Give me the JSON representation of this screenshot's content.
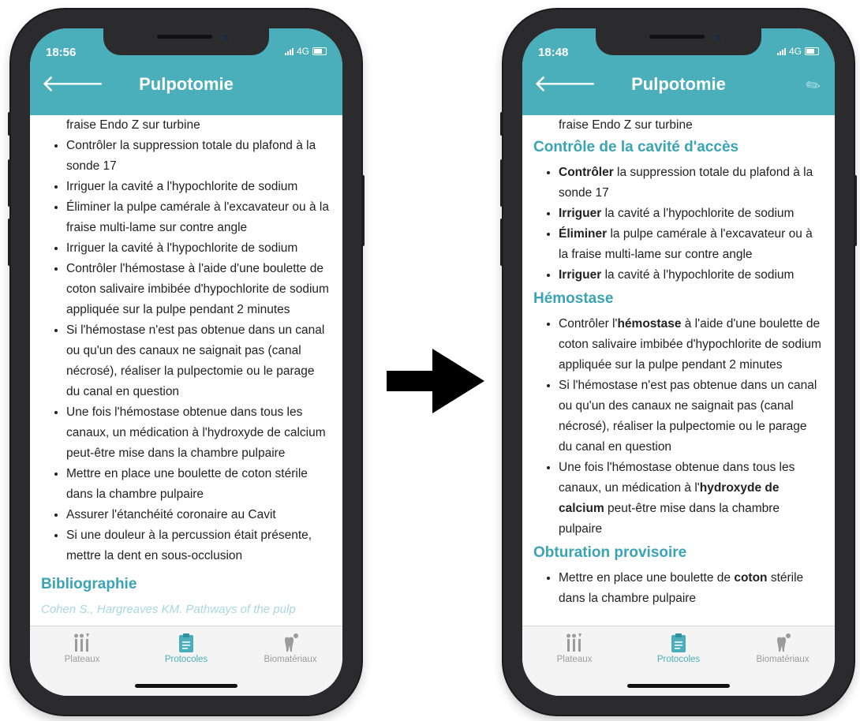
{
  "left": {
    "status": {
      "time": "18:56",
      "network": "4G"
    },
    "header": {
      "title": "Pulpotomie"
    },
    "content": {
      "top_fragment": "fraise Endo Z sur turbine",
      "items": [
        "Contrôler la suppression totale du plafond à la sonde 17",
        "Irriguer la cavité a l'hypochlorite de sodium",
        "Éliminer la pulpe camérale à l'excavateur ou à la fraise multi-lame sur contre angle",
        "Irriguer la cavité à l'hypochlorite de sodium",
        "Contrôler l'hémostase à l'aide d'une boulette de coton salivaire imbibée d'hypochlorite de sodium appliquée sur la pulpe pendant 2 minutes",
        "Si l'hémostase n'est pas obtenue dans un canal ou qu'un des canaux ne saignait pas (canal nécrosé), réaliser la pulpectomie ou le parage du canal en question",
        "Une fois l'hémostase obtenue dans tous les canaux, un médication à l'hydroxyde de calcium peut-être mise dans la chambre pulpaire",
        "Mettre en place une boulette de coton stérile dans la chambre pulpaire",
        "Assurer l'étanchéité coronaire au Cavit",
        "Si une douleur à la percussion était présente, mettre la dent en sous-occlusion"
      ],
      "bibliography_heading": "Bibliographie",
      "bibliography_fragment": "Cohen S., Hargreaves KM. Pathways of the pulp"
    },
    "tabs": [
      {
        "label": "Plateaux",
        "icon": "tools-icon"
      },
      {
        "label": "Protocoles",
        "icon": "clipboard-icon"
      },
      {
        "label": "Biomatériaux",
        "icon": "tooth-icon"
      }
    ]
  },
  "right": {
    "status": {
      "time": "18:48",
      "network": "4G"
    },
    "header": {
      "title": "Pulpotomie"
    },
    "content": {
      "top_fragment": "fraise Endo Z sur turbine",
      "section1": {
        "heading": "Contrôle de la cavité d'accès",
        "items": [
          {
            "bold": "Contrôler",
            "rest": " la suppression totale du plafond à la sonde 17"
          },
          {
            "bold": "Irriguer",
            "rest": " la cavité a l'hypochlorite de sodium"
          },
          {
            "bold": "Éliminer",
            "rest": " la pulpe camérale à l'excavateur ou à la fraise multi-lame sur contre angle"
          },
          {
            "bold": "Irriguer",
            "rest": " la cavité à l'hypochlorite de sodium"
          }
        ]
      },
      "section2": {
        "heading": "Hémostase",
        "item1": {
          "pre": "Contrôler l'",
          "bold": "hémostase",
          "post": " à l'aide d'une boulette de coton salivaire imbibée d'hypochlorite de sodium appliquée sur la pulpe pendant 2 minutes"
        },
        "item2": "Si l'hémostase n'est pas obtenue dans un canal ou qu'un des canaux ne saignait pas (canal nécrosé), réaliser la pulpectomie ou le parage du canal en question",
        "item3": {
          "pre": "Une fois l'hémostase obtenue dans tous les canaux, un médication à l'",
          "bold": "hydroxyde de calcium",
          "post": " peut-être mise dans la chambre pulpaire"
        }
      },
      "section3": {
        "heading": "Obturation provisoire",
        "item1": {
          "pre": "Mettre en place une boulette de ",
          "bold": "coton",
          "post": " stérile dans la chambre pulpaire"
        }
      }
    },
    "tabs": [
      {
        "label": "Plateaux",
        "icon": "tools-icon"
      },
      {
        "label": "Protocoles",
        "icon": "clipboard-icon"
      },
      {
        "label": "Biomatériaux",
        "icon": "tooth-icon"
      }
    ]
  },
  "colors": {
    "header": "#4aaebb",
    "heading_text": "#3aa3b4",
    "tab_active": "#4aaebb",
    "tab_inactive": "#9b9b9b"
  }
}
